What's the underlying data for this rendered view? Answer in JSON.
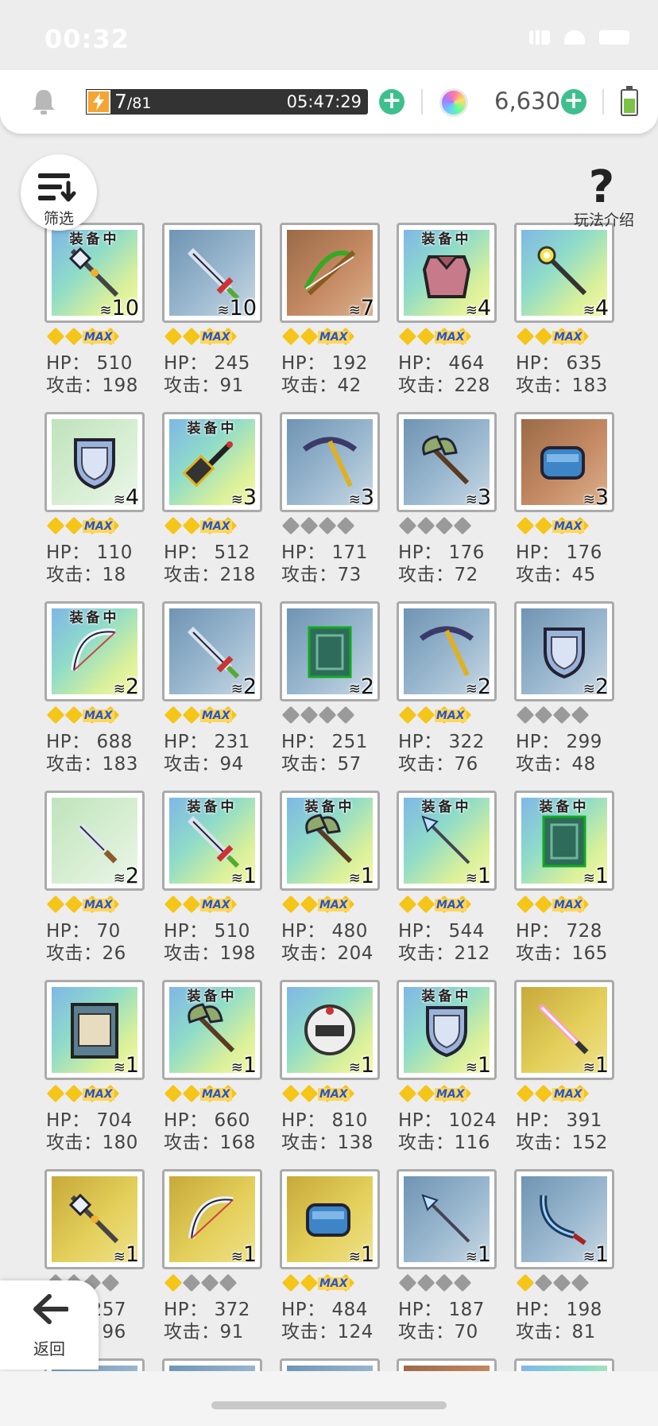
{
  "status_bar": {
    "time": "00:32"
  },
  "top_bar": {
    "energy_current": "7",
    "energy_max": "/81",
    "energy_ratio": 0.086,
    "energy_timer": "05:47:29",
    "gems": "6,630"
  },
  "filter_label": "筛选",
  "help_label": "玩法介绍",
  "back_label": "返回",
  "equipped_label": "装备中",
  "colors": {
    "gold_diamond": "#f5c518",
    "grey_diamond": "#9a9a9a",
    "max_tag_bg": "#ffd65a",
    "max_tag_text": "#2855c8",
    "plus_green": "#3fbf8e",
    "tier_gradient_rainbow": "#7dd8c6",
    "tier_blue": "#8fb3cc",
    "tier_gold": "#d9c34a",
    "tier_copper": "#b07a55",
    "tier_green": "#c9e6c3"
  },
  "items": [
    {
      "name": "halberd",
      "icon": "halberd-icon",
      "equipped": true,
      "count": "10",
      "stars": "2max",
      "hp": "HP： 510",
      "atk": "攻击：198",
      "bg": "rainbow"
    },
    {
      "name": "red-sword",
      "icon": "sword-icon",
      "equipped": false,
      "count": "10",
      "stars": "2max",
      "hp": "HP： 245",
      "atk": "攻击：91",
      "bg": "blue"
    },
    {
      "name": "crossbow",
      "icon": "crossbow-icon",
      "equipped": false,
      "count": "7",
      "stars": "2max",
      "hp": "HP： 192",
      "atk": "攻击：42",
      "bg": "copper"
    },
    {
      "name": "pink-armor",
      "icon": "armor-icon",
      "equipped": true,
      "count": "4",
      "stars": "2max",
      "hp": "HP： 464",
      "atk": "攻击：228",
      "bg": "rainbow"
    },
    {
      "name": "star-staff",
      "icon": "staff-icon",
      "equipped": false,
      "count": "4",
      "stars": "2max",
      "hp": "HP： 635",
      "atk": "攻击：183",
      "bg": "rainbow"
    },
    {
      "name": "round-shield",
      "icon": "shield-icon",
      "equipped": false,
      "count": "4",
      "stars": "2max",
      "hp": "HP： 110",
      "atk": "攻击：18",
      "bg": "green"
    },
    {
      "name": "dark-hammer",
      "icon": "hammer-icon",
      "equipped": true,
      "count": "3",
      "stars": "2max",
      "hp": "HP： 512",
      "atk": "攻击：218",
      "bg": "rainbow"
    },
    {
      "name": "pickaxe",
      "icon": "pickaxe-icon",
      "equipped": false,
      "count": "3",
      "stars": "grey",
      "hp": "HP： 171",
      "atk": "攻击：73",
      "bg": "blue"
    },
    {
      "name": "battle-axe",
      "icon": "axe-icon",
      "equipped": false,
      "count": "3",
      "stars": "grey",
      "hp": "HP： 176",
      "atk": "攻击：72",
      "bg": "blue"
    },
    {
      "name": "blue-gauntlet",
      "icon": "gauntlet-icon",
      "equipped": false,
      "count": "3",
      "stars": "2max",
      "hp": "HP： 176",
      "atk": "攻击：45",
      "bg": "copper"
    },
    {
      "name": "white-bow",
      "icon": "bow-icon",
      "equipped": true,
      "count": "2",
      "stars": "2max",
      "hp": "HP： 688",
      "atk": "攻击：183",
      "bg": "rainbow"
    },
    {
      "name": "broad-sword",
      "icon": "sword-icon",
      "equipped": false,
      "count": "2",
      "stars": "2max",
      "hp": "HP： 231",
      "atk": "攻击：94",
      "bg": "blue"
    },
    {
      "name": "green-book",
      "icon": "book-icon",
      "equipped": false,
      "count": "2",
      "stars": "grey",
      "hp": "HP： 251",
      "atk": "攻击：57",
      "bg": "blue"
    },
    {
      "name": "skull-pickaxe",
      "icon": "pickaxe-icon",
      "equipped": false,
      "count": "2",
      "stars": "2max",
      "hp": "HP： 322",
      "atk": "攻击：76",
      "bg": "blue"
    },
    {
      "name": "blue-gem-shield",
      "icon": "shield-icon",
      "equipped": false,
      "count": "2",
      "stars": "grey",
      "hp": "HP： 299",
      "atk": "攻击：48",
      "bg": "blue"
    },
    {
      "name": "dagger",
      "icon": "dagger-icon",
      "equipped": false,
      "count": "2",
      "stars": "2max",
      "hp": "HP： 70",
      "atk": "攻击：26",
      "bg": "green"
    },
    {
      "name": "purple-sword",
      "icon": "sword-icon",
      "equipped": true,
      "count": "1",
      "stars": "2max",
      "hp": "HP： 510",
      "atk": "攻击：198",
      "bg": "rainbow"
    },
    {
      "name": "double-axe",
      "icon": "axe-icon",
      "equipped": true,
      "count": "1",
      "stars": "2max",
      "hp": "HP： 480",
      "atk": "攻击：204",
      "bg": "rainbow"
    },
    {
      "name": "ice-spear",
      "icon": "spear-icon",
      "equipped": true,
      "count": "1",
      "stars": "2max",
      "hp": "HP： 544",
      "atk": "攻击：212",
      "bg": "rainbow"
    },
    {
      "name": "phoenix-tome",
      "icon": "book-icon",
      "equipped": true,
      "count": "1",
      "stars": "2max",
      "hp": "HP： 728",
      "atk": "攻击：165",
      "bg": "rainbow"
    },
    {
      "name": "tablet",
      "icon": "tablet-icon",
      "equipped": false,
      "count": "1",
      "stars": "2max",
      "hp": "HP： 704",
      "atk": "攻击：180",
      "bg": "rainbow"
    },
    {
      "name": "dark-axe",
      "icon": "axe-icon",
      "equipped": true,
      "count": "1",
      "stars": "2max",
      "hp": "HP： 660",
      "atk": "攻击：168",
      "bg": "rainbow"
    },
    {
      "name": "robot-helmet",
      "icon": "helmet-icon",
      "equipped": false,
      "count": "1",
      "stars": "2max",
      "hp": "HP： 810",
      "atk": "攻击：138",
      "bg": "rainbow"
    },
    {
      "name": "crest-shield",
      "icon": "shield-icon",
      "equipped": true,
      "count": "1",
      "stars": "2max",
      "hp": "HP： 1024",
      "atk": "攻击：116",
      "bg": "rainbow"
    },
    {
      "name": "light-saber",
      "icon": "saber-icon",
      "equipped": false,
      "count": "1",
      "stars": "2max",
      "hp": "HP： 391",
      "atk": "攻击：152",
      "bg": "gold"
    },
    {
      "name": "gold-halberd",
      "icon": "halberd-icon",
      "equipped": false,
      "count": "1",
      "stars": "grey",
      "hp": "HP：257",
      "atk": "攻击：96",
      "bg": "gold"
    },
    {
      "name": "gold-bow",
      "icon": "bow-icon",
      "equipped": false,
      "count": "1",
      "stars": "1gold",
      "hp": "HP： 372",
      "atk": "攻击：91",
      "bg": "gold"
    },
    {
      "name": "fire-gauntlet",
      "icon": "gauntlet-icon",
      "equipped": false,
      "count": "1",
      "stars": "2max",
      "hp": "HP： 484",
      "atk": "攻击：124",
      "bg": "gold"
    },
    {
      "name": "steel-spear",
      "icon": "spear-icon",
      "equipped": false,
      "count": "1",
      "stars": "grey",
      "hp": "HP： 187",
      "atk": "攻击：70",
      "bg": "blue"
    },
    {
      "name": "scimitar",
      "icon": "scimitar-icon",
      "equipped": false,
      "count": "1",
      "stars": "1gold",
      "hp": "HP： 198",
      "atk": "攻击：81",
      "bg": "blue"
    }
  ]
}
